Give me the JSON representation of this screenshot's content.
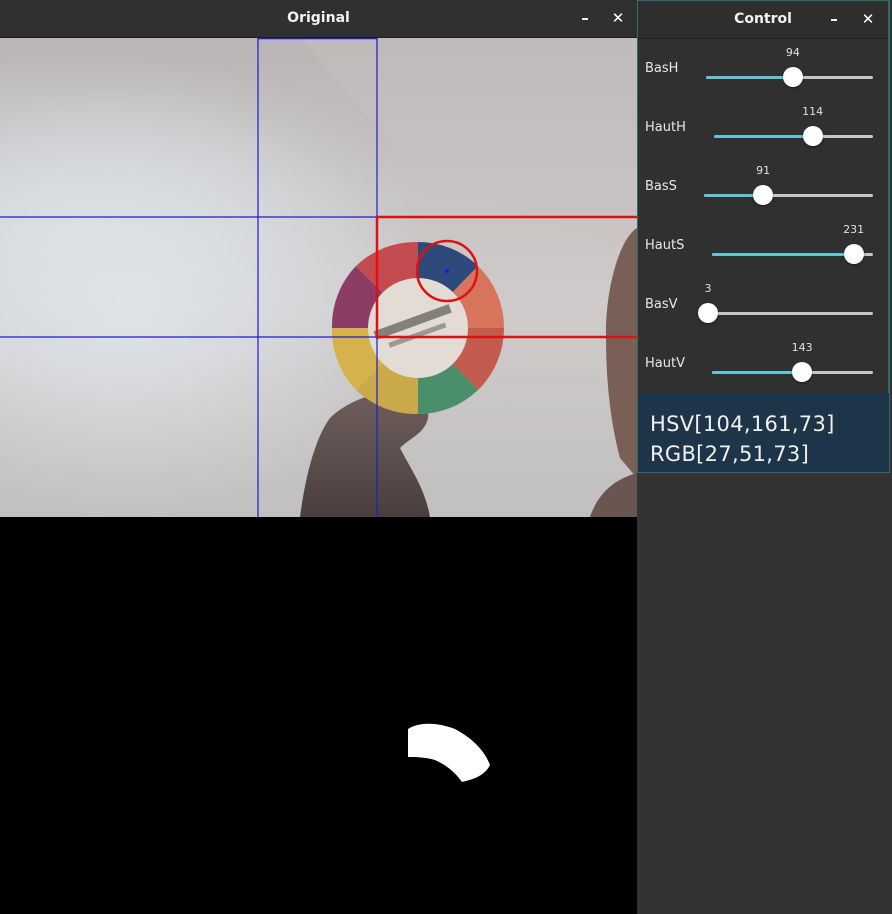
{
  "original_window": {
    "title": "Original",
    "minimize_glyph": "–",
    "close_glyph": "✕"
  },
  "control_window": {
    "title": "Control",
    "minimize_glyph": "–",
    "close_glyph": "✕",
    "sliders": [
      {
        "label": "BasH",
        "value": "94",
        "fraction": 0.52
      },
      {
        "label": "HautH",
        "value": "114",
        "fraction": 0.62
      },
      {
        "label": "BasS",
        "value": "91",
        "fraction": 0.35
      },
      {
        "label": "HautS",
        "value": "231",
        "fraction": 0.88
      },
      {
        "label": "BasV",
        "value": "3",
        "fraction": 0.0
      },
      {
        "label": "HautV",
        "value": "143",
        "fraction": 0.56
      }
    ],
    "hsv": "HSV[104,161,73]",
    "rgb": "RGB[27,51,73]"
  },
  "colors": {
    "accent": "#61c5d4",
    "grid_lines": "#1c1cd9",
    "detection": "#e01010",
    "readout_bg": "#1e3549"
  }
}
